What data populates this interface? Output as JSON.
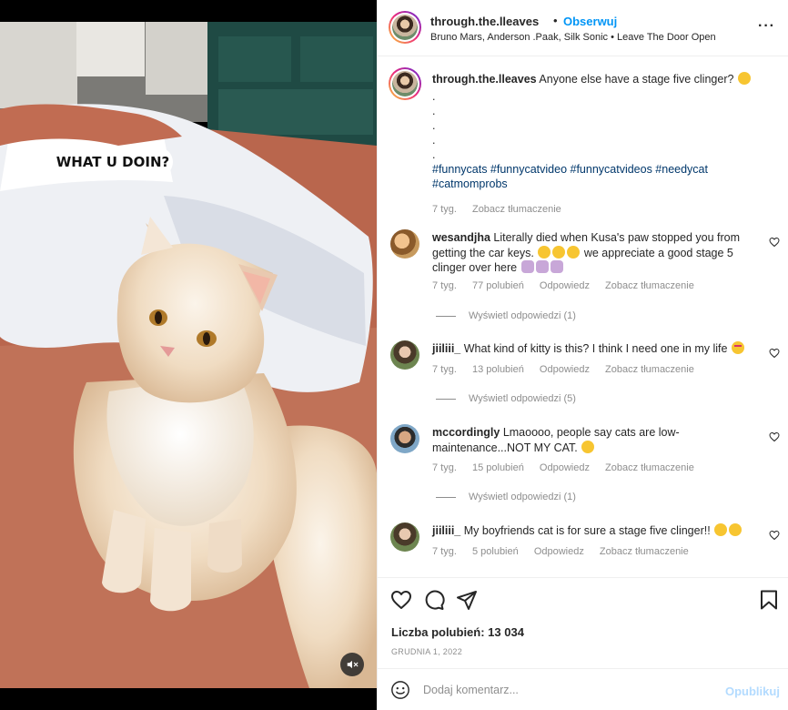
{
  "video": {
    "overlay_text": "WHAT U DOIN?",
    "mute_icon": "speaker-muted-icon"
  },
  "header": {
    "username": "through.the.lleaves",
    "separator": "•",
    "follow_label": "Obserwuj",
    "music": "Bruno Mars, Anderson .Paak, Silk Sonic • Leave The Door Open",
    "more_icon": "more-options-icon"
  },
  "caption": {
    "username": "through.the.lleaves",
    "text": "Anyone else have a stage five clinger?",
    "dots": [
      ".",
      ".",
      ".",
      ".",
      "."
    ],
    "hashtags": "#funnycats #funnycatvideo #funnycatvideos #needycat #catmomprobs",
    "time": "7 tyg.",
    "translate": "Zobacz tłumaczenie"
  },
  "comments": [
    {
      "username": "wesandjha",
      "text": "Literally died when Kusa's paw stopped you from getting the car keys.",
      "text_tail": "we appreciate a good stage 5 clinger over here",
      "time": "7 tyg.",
      "likes": "77 polubień",
      "reply": "Odpowiedz",
      "translate": "Zobacz tłumaczenie",
      "view_replies": "Wyświetl odpowiedzi (1)"
    },
    {
      "username": "jiiliii_",
      "text": "What kind of kitty is this? I think I need one in my life",
      "time": "7 tyg.",
      "likes": "13 polubień",
      "reply": "Odpowiedz",
      "translate": "Zobacz tłumaczenie",
      "view_replies": "Wyświetl odpowiedzi (5)"
    },
    {
      "username": "mccordingly",
      "text": "Lmaoooo, people say cats are low-maintenance...NOT MY CAT.",
      "time": "7 tyg.",
      "likes": "15 polubień",
      "reply": "Odpowiedz",
      "translate": "Zobacz tłumaczenie",
      "view_replies": "Wyświetl odpowiedzi (1)"
    },
    {
      "username": "jiiliii_",
      "text": "My boyfriends cat is for sure a stage five clinger!!",
      "time": "7 tyg.",
      "likes": "5 polubień",
      "reply": "Odpowiedz",
      "translate": "Zobacz tłumaczenie"
    }
  ],
  "actions": {
    "like_icon": "heart-icon",
    "comment_icon": "comment-icon",
    "share_icon": "share-icon",
    "save_icon": "bookmark-icon",
    "likes": "Liczba polubień: 13 034",
    "date": "GRUDNIA 1, 2022"
  },
  "composer": {
    "emoji_icon": "emoji-icon",
    "placeholder": "Dodaj komentarz...",
    "publish_label": "Opublikuj"
  },
  "colors": {
    "link_blue": "#0095f6",
    "hashtag": "#00376b",
    "muted_text": "#8e8e8e",
    "publish_disabled": "#b3dbff"
  }
}
